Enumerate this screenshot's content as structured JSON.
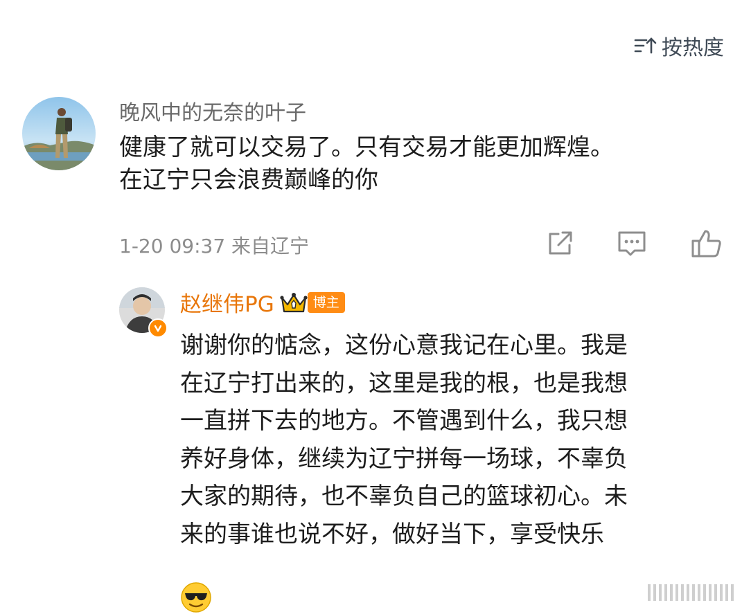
{
  "sort": {
    "label": "按热度",
    "icon": "sort-icon"
  },
  "comment": {
    "author": "晚风中的无奈的叶子",
    "text_lines": [
      "健康了就可以交易了。只有交易才能更加辉煌。",
      "在辽宁只会浪费巅峰的你"
    ],
    "meta": "1-20 09:37 来自辽宁",
    "actions": [
      "share-icon",
      "comment-icon",
      "like-icon"
    ]
  },
  "reply": {
    "author": "赵继伟PG",
    "badge": "博主",
    "text_lines": [
      "谢谢你的惦念，这份心意我记在心里。我是",
      "在辽宁打出来的，这里是我的根，也是我想",
      "一直拼下去的地方。不管遇到什么，我只想",
      "养好身体，继续为辽宁拼每一场球，不辜负",
      "大家的期待，也不辜负自己的篮球初心。未",
      "来的事谁也说不好，做好当下，享受快乐"
    ],
    "emoji": "cool-sunglasses-emoji"
  },
  "colors": {
    "accent": "#e8760a",
    "badge": "#ff8c14",
    "meta": "#8c8c8c"
  }
}
